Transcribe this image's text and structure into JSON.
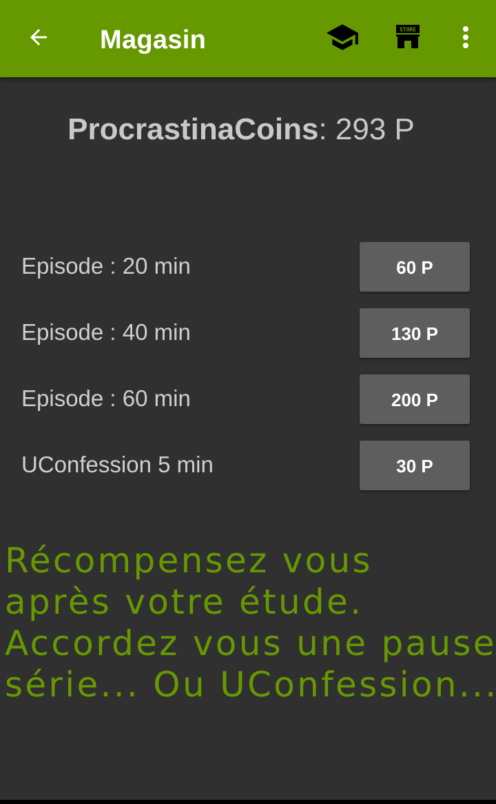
{
  "header": {
    "title": "Magasin",
    "back_icon": "arrow-left-icon",
    "actions": [
      "graduation-cap-icon",
      "store-icon",
      "more-vert-icon"
    ],
    "store_badge": "STORE"
  },
  "balance": {
    "label": "ProcrastinaCoins",
    "separator": ":",
    "value": "293 P"
  },
  "items": [
    {
      "name": "Episode : 20 min",
      "price": "60 P"
    },
    {
      "name": "Episode : 40 min",
      "price": "130 P"
    },
    {
      "name": "Episode : 60 min",
      "price": "200 P"
    },
    {
      "name": "UConfession 5 min",
      "price": "30 P"
    }
  ],
  "promo": {
    "lines": [
      "Récompensez vous",
      "après votre étude.",
      "Accordez vous une pause",
      "série... Ou UConfession..."
    ]
  },
  "colors": {
    "accent": "#669900",
    "background": "#303030",
    "button": "#5e5e5e"
  }
}
